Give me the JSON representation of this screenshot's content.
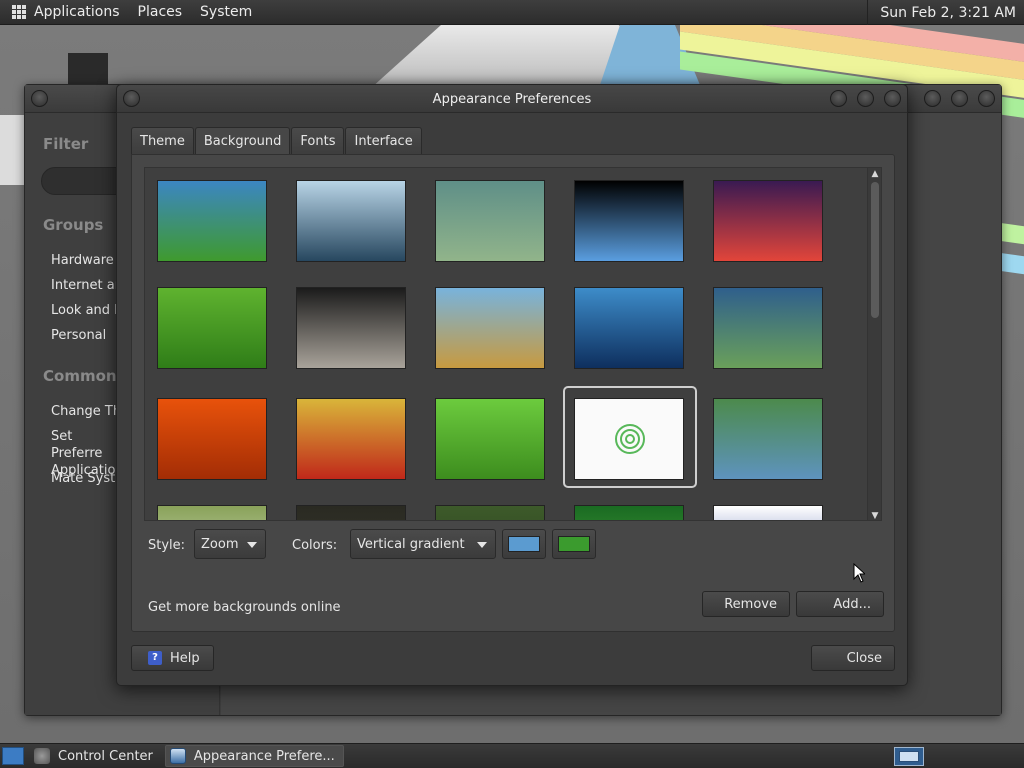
{
  "top_panel": {
    "menus": [
      "Applications",
      "Places",
      "System"
    ],
    "clock": "Sun Feb  2,  3:21 AM"
  },
  "control_center": {
    "sidebar": {
      "filter_heading": "Filter",
      "groups_heading": "Groups",
      "groups": [
        "Hardware",
        "Internet an",
        "Look and F",
        "Personal"
      ],
      "common_heading": "Common T",
      "common_tasks": [
        "Change Th",
        "Set Preferre Application",
        "Mate Syster"
      ]
    }
  },
  "dialog": {
    "title": "Appearance Preferences",
    "tabs": [
      {
        "label": "Theme",
        "active": false
      },
      {
        "label": "Background",
        "active": true
      },
      {
        "label": "Fonts",
        "active": false
      },
      {
        "label": "Interface",
        "active": false
      }
    ],
    "backgrounds": {
      "selected_index": 13,
      "thumbnails": [
        {
          "name": "green-blue-gradient",
          "colors": [
            "#3c86c2",
            "#3f9a2e"
          ]
        },
        {
          "name": "water-droplet",
          "colors": [
            "#b8d4e6",
            "#27475f"
          ]
        },
        {
          "name": "soft-green-haze",
          "colors": [
            "#5f8f88",
            "#91b48a"
          ]
        },
        {
          "name": "arch-logo-prism",
          "colors": [
            "#000000",
            "#5a9ee0"
          ]
        },
        {
          "name": "space-rocket",
          "colors": [
            "#3a1a52",
            "#e2453a"
          ]
        },
        {
          "name": "green-leaf",
          "colors": [
            "#5fb32f",
            "#2f7d18"
          ]
        },
        {
          "name": "spiral-galaxy",
          "colors": [
            "#1b1b1b",
            "#a9a39a"
          ]
        },
        {
          "name": "dune-grass",
          "colors": [
            "#78b3dc",
            "#c79a3f"
          ]
        },
        {
          "name": "blue-waves",
          "colors": [
            "#3d8cc9",
            "#0e2f5e"
          ]
        },
        {
          "name": "teal-bokeh",
          "colors": [
            "#2f5f8c",
            "#6aa05a"
          ]
        },
        {
          "name": "orange-flower",
          "colors": [
            "#e8520b",
            "#a32d05"
          ]
        },
        {
          "name": "red-flower",
          "colors": [
            "#d9b53a",
            "#c0281a"
          ]
        },
        {
          "name": "green-grass",
          "colors": [
            "#6ccb3e",
            "#3d8d1e"
          ]
        },
        {
          "name": "mate-logo-white",
          "colors": [
            "#ffffff",
            "#e9e9e9"
          ]
        },
        {
          "name": "green-teal-gradient",
          "colors": [
            "#4c8a4c",
            "#5e93be"
          ]
        },
        {
          "name": "partial-blossoms",
          "colors": [
            "#8aa25a",
            "#d5e5c8"
          ]
        },
        {
          "name": "partial-dark",
          "colors": [
            "#2a2a22",
            "#3a3a30"
          ]
        },
        {
          "name": "partial-green-dark",
          "colors": [
            "#3d5a2a",
            "#2a3f1e"
          ]
        },
        {
          "name": "partial-green-leaf",
          "colors": [
            "#1a6b22",
            "#50a840"
          ]
        },
        {
          "name": "partial-blue-object",
          "colors": [
            "#ffffff",
            "#3a4fa0"
          ]
        }
      ]
    },
    "style_label": "Style:",
    "style_value": "Zoom",
    "colors_label": "Colors:",
    "colors_value": "Vertical gradient",
    "primary_color": "#5b9bd0",
    "secondary_color": "#3b9b2e",
    "more_online": "Get more backgrounds online",
    "remove_label": "Remove",
    "add_label": "Add...",
    "help_label": "Help",
    "close_label": "Close"
  },
  "taskbar": {
    "tasks": [
      {
        "label": "Control Center",
        "active": false
      },
      {
        "label": "Appearance Prefere...",
        "active": true
      }
    ]
  }
}
